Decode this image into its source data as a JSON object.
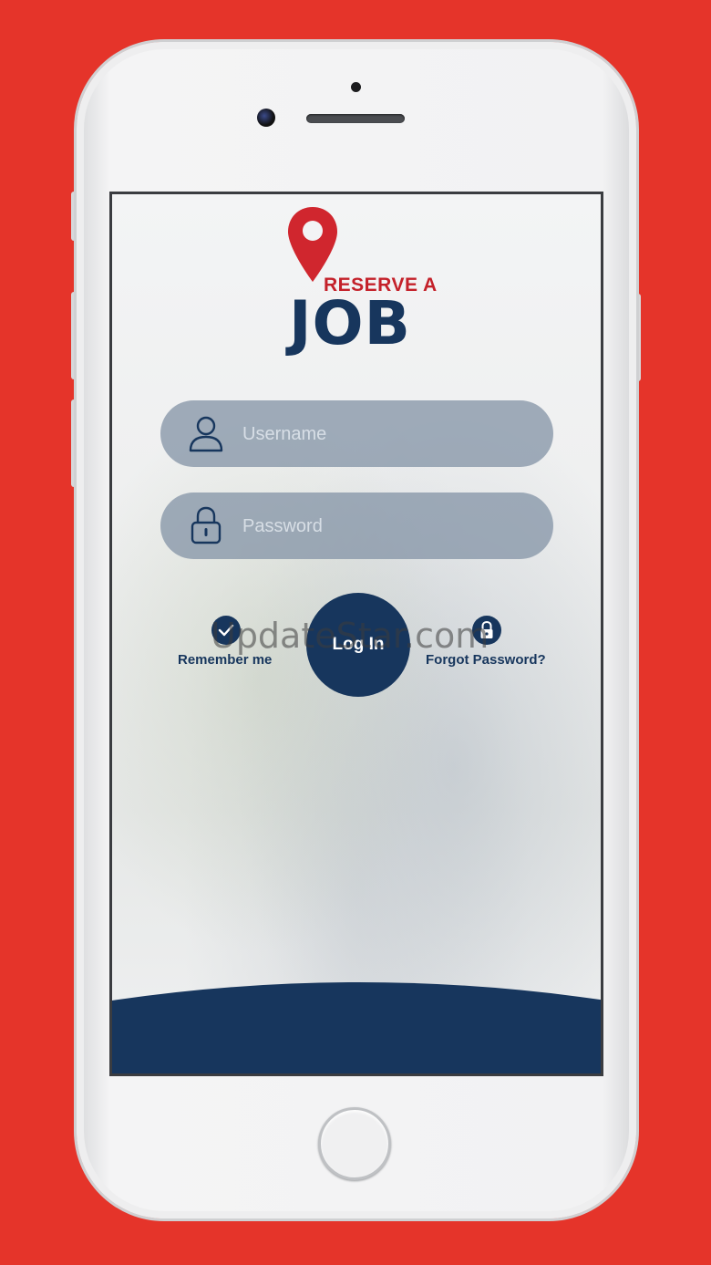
{
  "app": {
    "logo": {
      "line1": "RESERVE A",
      "line2": "JOB",
      "pin_color": "#d0262e",
      "text_color": "#17365d"
    }
  },
  "login_form": {
    "username": {
      "placeholder": "Username",
      "value": "",
      "icon": "user-icon"
    },
    "password": {
      "placeholder": "Password",
      "value": "",
      "icon": "lock-icon"
    },
    "remember_me": {
      "label": "Remember me",
      "checked": true,
      "icon": "checkmark-icon"
    },
    "login_button": {
      "label": "Log In"
    },
    "forgot_password": {
      "label": "Forgot Password?",
      "icon": "lock-icon"
    }
  },
  "watermark": {
    "text": "UpdateStar.com"
  },
  "colors": {
    "background": "#e5342a",
    "brand_navy": "#17365d",
    "brand_red": "#c4212a",
    "field_fill": "#8696a8"
  }
}
